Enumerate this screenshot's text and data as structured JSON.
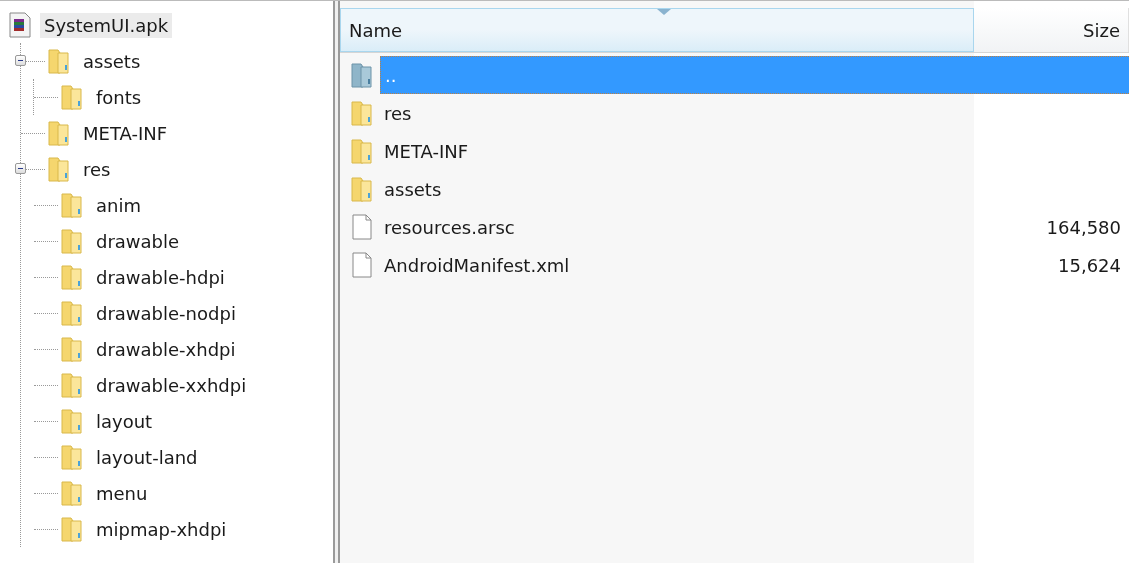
{
  "tree": {
    "label": "SystemUI.apk",
    "kind": "archive",
    "selected": true,
    "children": [
      {
        "label": "assets",
        "kind": "folder",
        "selected": false,
        "expanded": true,
        "children": [
          {
            "label": "fonts",
            "kind": "folder",
            "selected": false
          }
        ]
      },
      {
        "label": "META-INF",
        "kind": "folder",
        "selected": false
      },
      {
        "label": "res",
        "kind": "folder",
        "selected": false,
        "expanded": true,
        "children": [
          {
            "label": "anim",
            "kind": "folder",
            "selected": false
          },
          {
            "label": "drawable",
            "kind": "folder",
            "selected": false
          },
          {
            "label": "drawable-hdpi",
            "kind": "folder",
            "selected": false
          },
          {
            "label": "drawable-nodpi",
            "kind": "folder",
            "selected": false
          },
          {
            "label": "drawable-xhdpi",
            "kind": "folder",
            "selected": false
          },
          {
            "label": "drawable-xxhdpi",
            "kind": "folder",
            "selected": false
          },
          {
            "label": "layout",
            "kind": "folder",
            "selected": false
          },
          {
            "label": "layout-land",
            "kind": "folder",
            "selected": false
          },
          {
            "label": "menu",
            "kind": "folder",
            "selected": false
          },
          {
            "label": "mipmap-xhdpi",
            "kind": "folder",
            "selected": false
          }
        ]
      }
    ]
  },
  "file_list": {
    "columns": [
      {
        "label": "Name",
        "sorted": true
      },
      {
        "label": "Size",
        "sorted": false
      }
    ],
    "rows": [
      {
        "name": "..",
        "kind": "up",
        "selected": true
      },
      {
        "name": "res",
        "kind": "folder",
        "selected": false
      },
      {
        "name": "META-INF",
        "kind": "folder",
        "selected": false
      },
      {
        "name": "assets",
        "kind": "folder",
        "selected": false
      },
      {
        "name": "resources.arsc",
        "kind": "file",
        "size": "164,580",
        "selected": false
      },
      {
        "name": "AndroidManifest.xml",
        "kind": "file",
        "size": "15,624",
        "selected": false
      }
    ]
  }
}
